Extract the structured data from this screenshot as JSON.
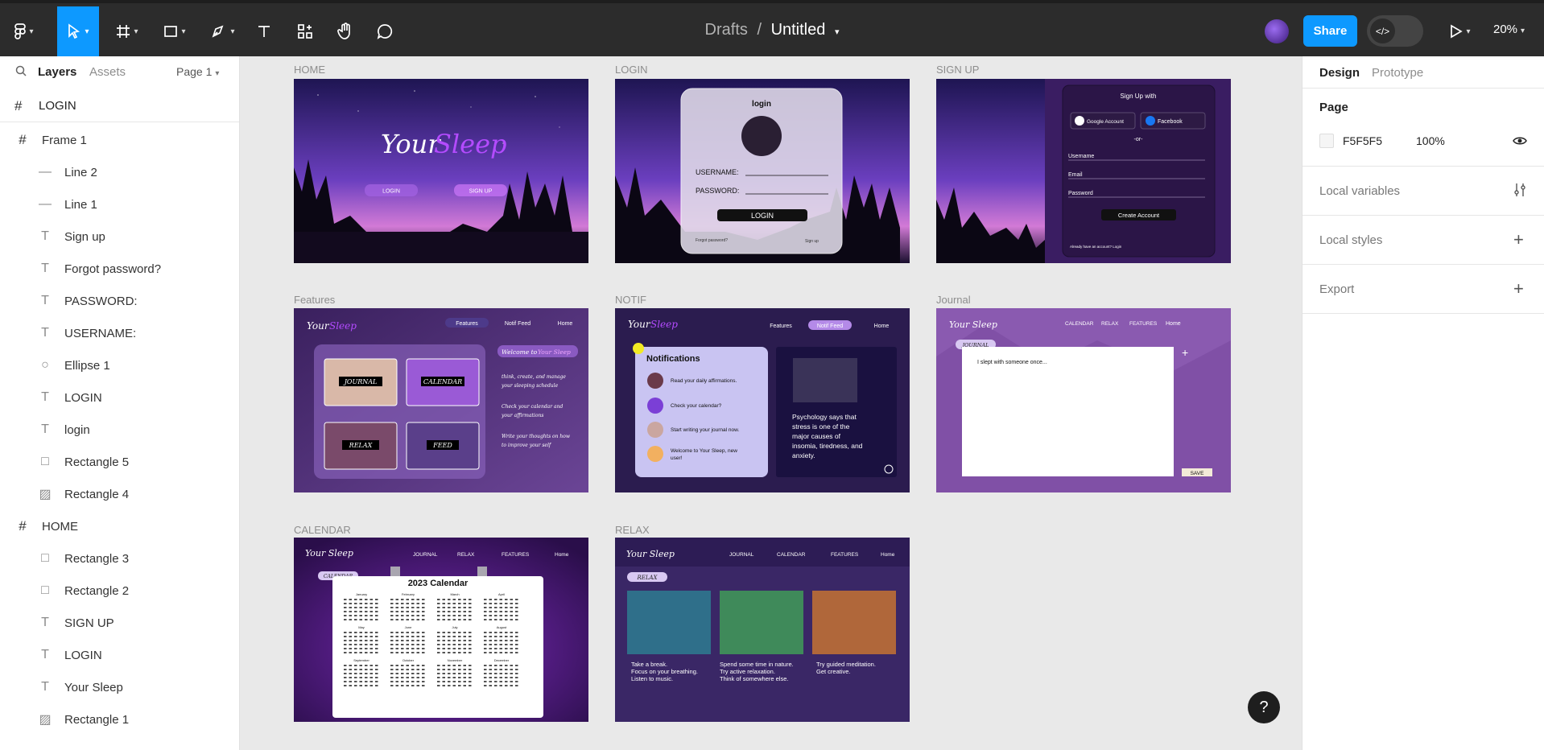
{
  "toolbar": {
    "breadcrumb_parent": "Drafts",
    "breadcrumb_sep": "/",
    "file_name": "Untitled",
    "share_label": "Share",
    "zoom": "20%",
    "accent": "#0d99ff"
  },
  "left_panel": {
    "tabs": [
      "Layers",
      "Assets"
    ],
    "page_selector": "Page 1",
    "top_frame": "LOGIN",
    "layers": [
      {
        "name": "Frame 1",
        "icon": "frame-icon"
      },
      {
        "name": "Line 2",
        "icon": "line-icon"
      },
      {
        "name": "Line 1",
        "icon": "line-icon"
      },
      {
        "name": "Sign up",
        "icon": "text-icon"
      },
      {
        "name": "Forgot password?",
        "icon": "text-icon"
      },
      {
        "name": "PASSWORD:",
        "icon": "text-icon"
      },
      {
        "name": "USERNAME:",
        "icon": "text-icon"
      },
      {
        "name": "Ellipse 1",
        "icon": "ellipse-icon"
      },
      {
        "name": "LOGIN",
        "icon": "text-icon"
      },
      {
        "name": "login",
        "icon": "text-icon"
      },
      {
        "name": "Rectangle 5",
        "icon": "rectangle-icon"
      },
      {
        "name": "Rectangle 4",
        "icon": "image-icon"
      },
      {
        "name": "HOME",
        "icon": "frame-icon"
      },
      {
        "name": "Rectangle 3",
        "icon": "rectangle-icon"
      },
      {
        "name": "Rectangle 2",
        "icon": "rectangle-icon"
      },
      {
        "name": "SIGN UP",
        "icon": "text-icon"
      },
      {
        "name": "LOGIN",
        "icon": "text-icon"
      },
      {
        "name": "Your Sleep",
        "icon": "text-icon"
      },
      {
        "name": "Rectangle 1",
        "icon": "image-icon"
      }
    ]
  },
  "right_panel": {
    "tabs": [
      "Design",
      "Prototype"
    ],
    "page_heading": "Page",
    "page_color": "F5F5F5",
    "page_opacity": "100%",
    "sections": [
      "Local variables",
      "Local styles",
      "Export"
    ]
  },
  "frames": {
    "home": {
      "label": "HOME",
      "brand_a": "Your",
      "brand_b": "Sleep",
      "login": "LOGIN",
      "signup": "SIGN UP"
    },
    "login": {
      "label": "LOGIN",
      "title": "login",
      "username": "USERNAME:",
      "password": "PASSWORD:",
      "button": "LOGIN",
      "forgot": "Forgot password?",
      "signup": "Sign up"
    },
    "signup": {
      "label": "SIGN UP",
      "title": "Sign Up with",
      "google": "Google Account",
      "facebook": "Facebook",
      "or": "-or-",
      "username": "Username",
      "email": "Email",
      "password": "Password",
      "button": "Create Account",
      "footer": "Already have an account? Login"
    },
    "features": {
      "label": "Features",
      "brand_a": "Your",
      "brand_b": "Sleep",
      "nav": [
        "Features",
        "Notif Feed",
        "Home"
      ],
      "cards": [
        "JOURNAL",
        "CALENDAR",
        "RELAX",
        "FEED"
      ],
      "welcome_a": "Welcome to",
      "welcome_b": "Your Sleep",
      "line1": "think, create, and manage",
      "line2": "your sleeping schedule",
      "line3": "Check your calendar and",
      "line4": "your affirmations",
      "line5": "Write your thoughts on how",
      "line6": "to improve your self"
    },
    "notif": {
      "label": "NOTIF",
      "brand_a": "Your",
      "brand_b": "Sleep",
      "nav": [
        "Features",
        "Notif Feed",
        "Home"
      ],
      "title": "Notifications",
      "items": [
        "Read your daily affirmations.",
        "Check your calendar?",
        "Start writing your journal now.",
        "Welcome to Your Sleep, new",
        "user!"
      ],
      "psych": [
        "Psychology says that",
        "stress is one of the",
        "major causes of",
        "insomia, tiredness, and",
        "anxiety."
      ]
    },
    "journal": {
      "label": "Journal",
      "brand": "Your Sleep",
      "nav": [
        "CALENDAR",
        "RELAX",
        "FEATURES",
        "Home"
      ],
      "tag": "JOURNAL",
      "text": "I slept with someone once...",
      "save": "SAVE"
    },
    "calendar": {
      "label": "CALENDAR",
      "brand": "Your Sleep",
      "nav": [
        "JOURNAL",
        "RELAX",
        "FEATURES",
        "Home"
      ],
      "tag": "CALENDAR",
      "title": "2023 Calendar",
      "months": [
        "January",
        "February",
        "March",
        "April",
        "May",
        "June",
        "July",
        "August",
        "September",
        "October",
        "November",
        "December"
      ]
    },
    "relax": {
      "label": "RELAX",
      "brand": "Your Sleep",
      "nav": [
        "JOURNAL",
        "CALENDAR",
        "FEATURES",
        "Home"
      ],
      "tag": "RELAX",
      "c1": [
        "Take a break.",
        "Focus on your breathing.",
        "Listen to music."
      ],
      "c2": [
        "Spend some time in nature.",
        "Try active relaxation.",
        "Think of somewhere else."
      ],
      "c3": [
        "Try guided meditation.",
        "Get creative."
      ]
    }
  },
  "help_label": "?"
}
